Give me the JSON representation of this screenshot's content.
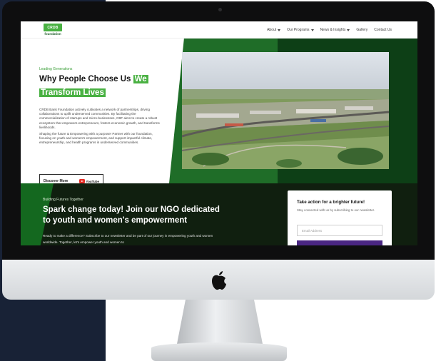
{
  "header": {
    "logo_mark": "CRDB",
    "logo_text": "foundation",
    "nav": [
      {
        "label": "About",
        "has_dropdown": true
      },
      {
        "label": "Our Programs",
        "has_dropdown": true
      },
      {
        "label": "News & Insights",
        "has_dropdown": true
      },
      {
        "label": "Gallery",
        "has_dropdown": false
      },
      {
        "label": "Contact Us",
        "has_dropdown": false
      }
    ]
  },
  "hero": {
    "eyebrow": "Leading Generations",
    "title_part1": "Why People Choose Us",
    "title_highlight1": "We",
    "title_highlight2": "Transform Lives",
    "paragraph1": "CRDB Bank Foundation actively cultivates a network of partnerships, driving collaborations to uplift underserved communities. By facilitating the commercialization of startups and micro-businesses, CBF aims to create a robust ecosystem that empowers entrepreneurs, fosters economic growth, and transforms livelihoods.",
    "paragraph2": "Shaping the future & Empowering with a purpose! Partner with our foundation, focusing on youth and women's empowerment, and support impactful climate, entrepreneurship, and health programs in underserved communities.",
    "cta_label": "Discover More",
    "youtube_label": "YouTube"
  },
  "newsletter_section": {
    "eyebrow": "Building Futures Together",
    "title": "Spark change today! Join our NGO dedicated to youth and women's empowerment",
    "body": "Ready to make a difference? Subscribe to our newsletter and be part of our journey in empowering youth and women worldwide. Together, let's empower youth and women to",
    "card_title": "Take action for a brighter future!",
    "card_subtitle": "Stay connected with us by subscribing to our newsletter.",
    "email_placeholder": "Email Address"
  },
  "colors": {
    "brand_green": "#49b142",
    "dark_green": "#0d3f16",
    "section_dark": "#101f0f",
    "button_purple": "#4a2683",
    "page_left_navy": "#182236"
  },
  "icons": [
    "apple-logo-icon",
    "youtube-icon",
    "chevron-down-icon"
  ]
}
